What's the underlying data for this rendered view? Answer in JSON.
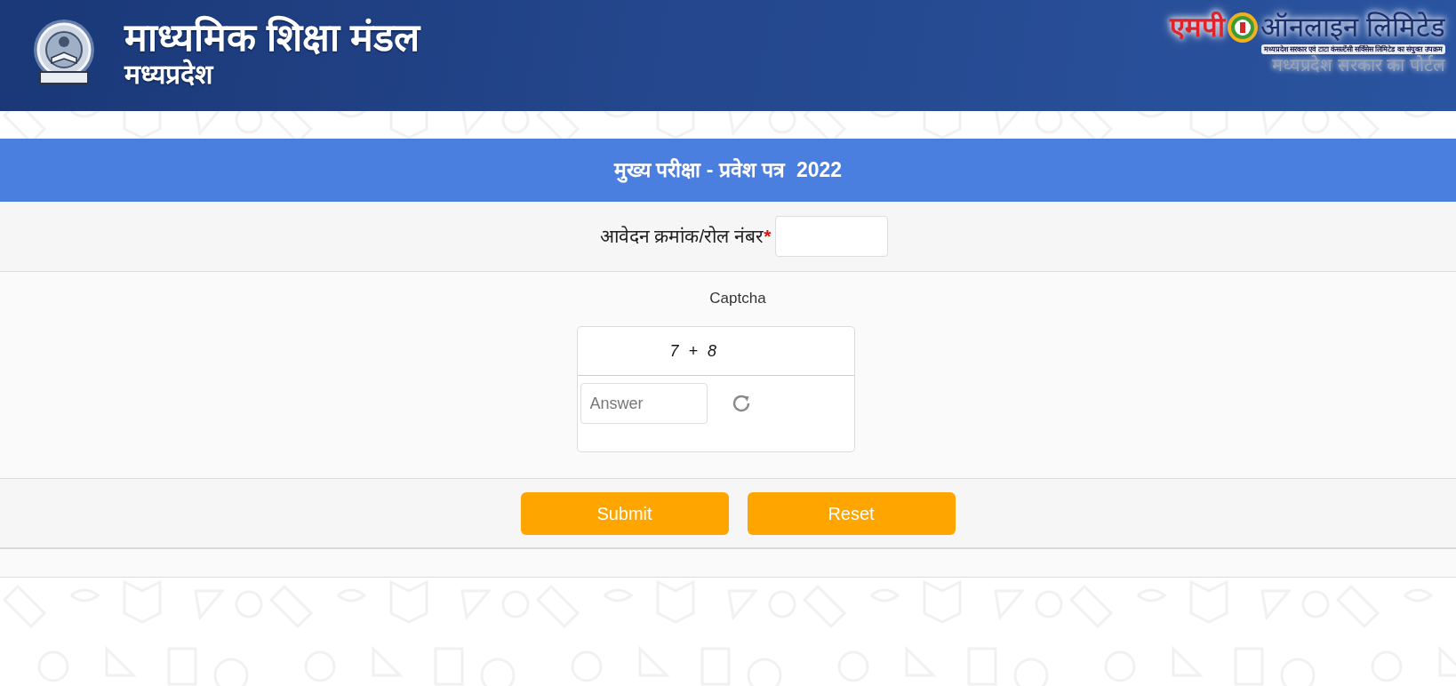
{
  "header": {
    "title": "माध्यमिक शिक्षा मंडल",
    "subtitle": "मध्यप्रदेश"
  },
  "partner_logo": {
    "prefix": "एमपी",
    "name": "ऑनलाइन लिमिटेड",
    "tagline": "मध्यप्रदेश सरकार एवं टाटा कंसल्टेंसी सर्विसेस लिमिटेड का संयुक्त उपक्रम",
    "caption": "मध्यप्रदेश सरकार का पोर्टल"
  },
  "form": {
    "title": "मुख्य परीक्षा - प्रवेश पत्र  2022",
    "fields": [
      {
        "label": "आवेदन क्रमांक/रोल नंबर",
        "required_mark": "*"
      }
    ],
    "captcha": {
      "label": "Captcha",
      "question": "7 + 8",
      "answer_placeholder": "Answer"
    },
    "buttons": [
      "Submit",
      "Reset"
    ]
  }
}
